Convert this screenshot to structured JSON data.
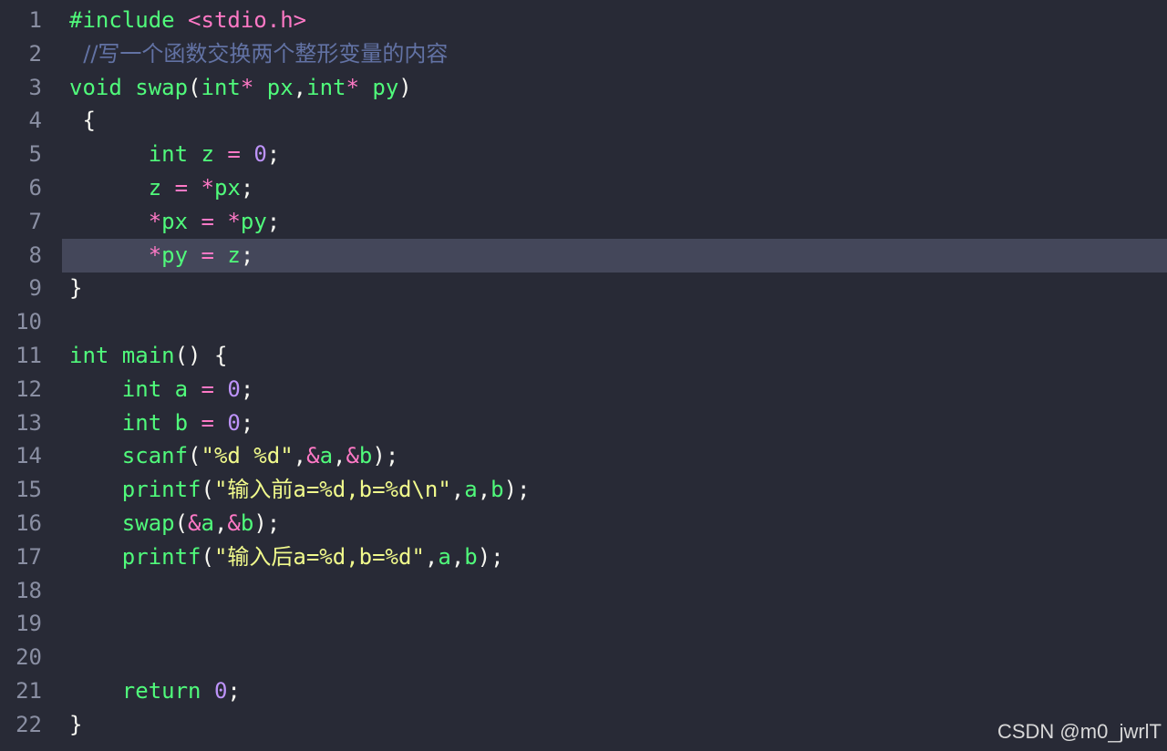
{
  "editor": {
    "active_line": 8,
    "lines": [
      {
        "number": "1",
        "tokens": [
          {
            "t": "#include ",
            "c": "kw"
          },
          {
            "t": "<stdio.h>",
            "c": "op"
          }
        ]
      },
      {
        "number": "2",
        "tokens": [
          {
            "t": "  //写一个函数交换两个整形变量的内容",
            "c": "cm"
          }
        ]
      },
      {
        "number": "3",
        "tokens": [
          {
            "t": "void ",
            "c": "kw"
          },
          {
            "t": "swap",
            "c": "fn"
          },
          {
            "t": "(",
            "c": "pl"
          },
          {
            "t": "int",
            "c": "kw"
          },
          {
            "t": "* ",
            "c": "op"
          },
          {
            "t": "px",
            "c": "kw"
          },
          {
            "t": ",",
            "c": "pl"
          },
          {
            "t": "int",
            "c": "kw"
          },
          {
            "t": "* ",
            "c": "op"
          },
          {
            "t": "py",
            "c": "kw"
          },
          {
            "t": ")",
            "c": "pl"
          }
        ]
      },
      {
        "number": "4",
        "tokens": [
          {
            "t": " {",
            "c": "pl"
          }
        ]
      },
      {
        "number": "5",
        "tokens": [
          {
            "t": "      int ",
            "c": "kw"
          },
          {
            "t": "z ",
            "c": "kw"
          },
          {
            "t": "= ",
            "c": "op"
          },
          {
            "t": "0",
            "c": "num"
          },
          {
            "t": ";",
            "c": "pl"
          }
        ]
      },
      {
        "number": "6",
        "tokens": [
          {
            "t": "      z ",
            "c": "kw"
          },
          {
            "t": "= *",
            "c": "op"
          },
          {
            "t": "px",
            "c": "kw"
          },
          {
            "t": ";",
            "c": "pl"
          }
        ]
      },
      {
        "number": "7",
        "tokens": [
          {
            "t": "      *",
            "c": "op"
          },
          {
            "t": "px ",
            "c": "kw"
          },
          {
            "t": "= *",
            "c": "op"
          },
          {
            "t": "py",
            "c": "kw"
          },
          {
            "t": ";",
            "c": "pl"
          }
        ]
      },
      {
        "number": "8",
        "tokens": [
          {
            "t": "      *",
            "c": "op"
          },
          {
            "t": "py ",
            "c": "kw"
          },
          {
            "t": "= ",
            "c": "op"
          },
          {
            "t": "z",
            "c": "kw"
          },
          {
            "t": ";",
            "c": "pl"
          }
        ]
      },
      {
        "number": "9",
        "tokens": [
          {
            "t": "}",
            "c": "pl"
          }
        ]
      },
      {
        "number": "10",
        "tokens": []
      },
      {
        "number": "11",
        "tokens": [
          {
            "t": "int ",
            "c": "kw"
          },
          {
            "t": "main",
            "c": "fn"
          },
          {
            "t": "() {",
            "c": "pl"
          }
        ]
      },
      {
        "number": "12",
        "tokens": [
          {
            "t": "    int ",
            "c": "kw"
          },
          {
            "t": "a ",
            "c": "kw"
          },
          {
            "t": "= ",
            "c": "op"
          },
          {
            "t": "0",
            "c": "num"
          },
          {
            "t": ";",
            "c": "pl"
          }
        ]
      },
      {
        "number": "13",
        "tokens": [
          {
            "t": "    int ",
            "c": "kw"
          },
          {
            "t": "b ",
            "c": "kw"
          },
          {
            "t": "= ",
            "c": "op"
          },
          {
            "t": "0",
            "c": "num"
          },
          {
            "t": ";",
            "c": "pl"
          }
        ]
      },
      {
        "number": "14",
        "tokens": [
          {
            "t": "    scanf",
            "c": "fn"
          },
          {
            "t": "(",
            "c": "pl"
          },
          {
            "t": "\"%d %d\"",
            "c": "str"
          },
          {
            "t": ",",
            "c": "pl"
          },
          {
            "t": "&",
            "c": "op"
          },
          {
            "t": "a",
            "c": "kw"
          },
          {
            "t": ",",
            "c": "pl"
          },
          {
            "t": "&",
            "c": "op"
          },
          {
            "t": "b",
            "c": "kw"
          },
          {
            "t": ");",
            "c": "pl"
          }
        ]
      },
      {
        "number": "15",
        "tokens": [
          {
            "t": "    printf",
            "c": "fn"
          },
          {
            "t": "(",
            "c": "pl"
          },
          {
            "t": "\"输入前a=%d,b=%d\\n\"",
            "c": "str"
          },
          {
            "t": ",",
            "c": "pl"
          },
          {
            "t": "a",
            "c": "kw"
          },
          {
            "t": ",",
            "c": "pl"
          },
          {
            "t": "b",
            "c": "kw"
          },
          {
            "t": ");",
            "c": "pl"
          }
        ]
      },
      {
        "number": "16",
        "tokens": [
          {
            "t": "    swap",
            "c": "fn"
          },
          {
            "t": "(",
            "c": "pl"
          },
          {
            "t": "&",
            "c": "op"
          },
          {
            "t": "a",
            "c": "kw"
          },
          {
            "t": ",",
            "c": "pl"
          },
          {
            "t": "&",
            "c": "op"
          },
          {
            "t": "b",
            "c": "kw"
          },
          {
            "t": ");",
            "c": "pl"
          }
        ]
      },
      {
        "number": "17",
        "tokens": [
          {
            "t": "    printf",
            "c": "fn"
          },
          {
            "t": "(",
            "c": "pl"
          },
          {
            "t": "\"输入后a=%d,b=%d\"",
            "c": "str"
          },
          {
            "t": ",",
            "c": "pl"
          },
          {
            "t": "a",
            "c": "kw"
          },
          {
            "t": ",",
            "c": "pl"
          },
          {
            "t": "b",
            "c": "kw"
          },
          {
            "t": ");",
            "c": "pl"
          }
        ]
      },
      {
        "number": "18",
        "tokens": []
      },
      {
        "number": "19",
        "tokens": []
      },
      {
        "number": "20",
        "tokens": []
      },
      {
        "number": "21",
        "tokens": [
          {
            "t": "    return ",
            "c": "kw"
          },
          {
            "t": "0",
            "c": "num"
          },
          {
            "t": ";",
            "c": "pl"
          }
        ]
      },
      {
        "number": "22",
        "tokens": [
          {
            "t": "}",
            "c": "pl"
          }
        ]
      }
    ]
  },
  "watermark": "CSDN @m0_jwrlT",
  "colors": {
    "background": "#282a36",
    "active_line_bg": "#44475a",
    "keyword": "#50fa7b",
    "operator": "#ff79c6",
    "number": "#bd93f9",
    "string": "#f1fa8c",
    "comment": "#6272a4",
    "line_number": "#8a8fa3"
  }
}
